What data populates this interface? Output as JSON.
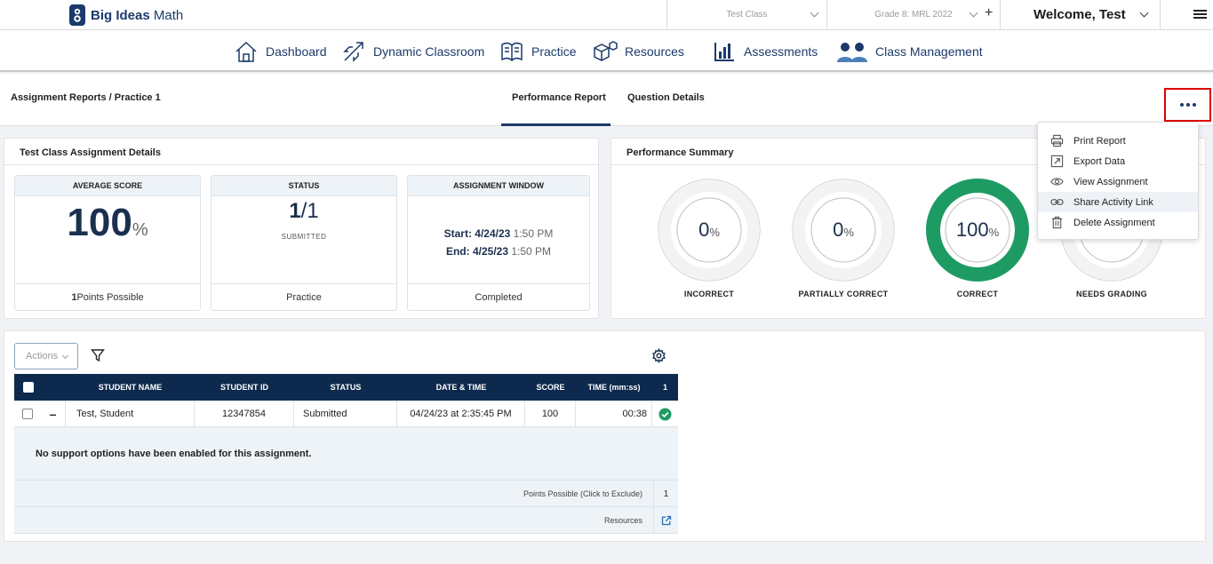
{
  "app": {
    "logo_bold": "Big Ideas",
    "logo_rest": " Math",
    "class_select": "Test Class",
    "grade_select": "Grade 8: MRL 2022",
    "welcome": "Welcome, Test"
  },
  "nav": {
    "items": [
      {
        "label": "Dashboard",
        "icon": "home-icon"
      },
      {
        "label": "Dynamic Classroom",
        "icon": "rocket-icon"
      },
      {
        "label": "Practice",
        "icon": "book-icon"
      },
      {
        "label": "Resources",
        "icon": "cubes-icon"
      },
      {
        "label": "Assessments",
        "icon": "bar-chart-icon"
      },
      {
        "label": "Class Management",
        "icon": "people-icon"
      }
    ]
  },
  "subheader": {
    "breadcrumb": "Assignment Reports / Practice 1",
    "tabs": [
      {
        "label": "Performance Report",
        "active": true
      },
      {
        "label": "Question Details",
        "active": false
      }
    ]
  },
  "details": {
    "title": "Test Class Assignment Details",
    "average": {
      "head": "AVERAGE SCORE",
      "value": "100",
      "unit": "%",
      "foot_num": "1",
      "foot_text": " Points Possible"
    },
    "status": {
      "head": "STATUS",
      "num": "1",
      "denom": "/1",
      "sub": "SUBMITTED",
      "foot": "Practice"
    },
    "window": {
      "head": "ASSIGNMENT WINDOW",
      "start_label": "Start:",
      "start_date": " 4/24/23",
      "start_time": " 1:50 PM",
      "end_label": "End:",
      "end_date": " 4/25/23",
      "end_time": " 1:50 PM",
      "foot": "Completed"
    }
  },
  "summary": {
    "title": "Performance Summary",
    "donuts": [
      {
        "value": "0",
        "unit": "%",
        "label": "INCORRECT",
        "fraction": 0
      },
      {
        "value": "0",
        "unit": "%",
        "label": "PARTIALLY CORRECT",
        "fraction": 0
      },
      {
        "value": "100",
        "unit": "%",
        "label": "CORRECT",
        "fraction": 1
      },
      {
        "value": "",
        "unit": "",
        "label": "NEEDS GRADING",
        "fraction": 0
      }
    ],
    "correct_color": "#1e9b63"
  },
  "menu": {
    "items": [
      {
        "label": "Print Report",
        "icon": "printer-icon"
      },
      {
        "label": "Export Data",
        "icon": "export-icon"
      },
      {
        "label": "View Assignment",
        "icon": "eye-icon"
      },
      {
        "label": "Share Activity Link",
        "icon": "link-icon",
        "highlighted": true
      },
      {
        "label": "Delete Assignment",
        "icon": "trash-icon"
      }
    ]
  },
  "table": {
    "actions_label": "Actions",
    "columns": [
      "STUDENT NAME",
      "STUDENT ID",
      "STATUS",
      "DATE & TIME",
      "SCORE",
      "TIME (mm:ss)",
      "1"
    ],
    "rows": [
      {
        "name": "Test, Student",
        "id": "12347854",
        "status": "Submitted",
        "datetime": "04/24/23 at 2:35:45 PM",
        "score": "100",
        "time": "00:38"
      }
    ],
    "support_msg": "No support options have been enabled for this assignment.",
    "points_label": "Points Possible (Click to Exclude)",
    "points_value": "1",
    "resources_label": "Resources"
  }
}
